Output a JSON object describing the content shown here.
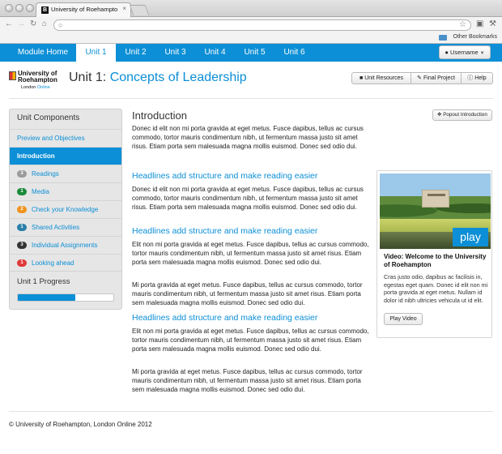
{
  "browser": {
    "tab_title": "University of Roehampton, L",
    "tab_close": "×",
    "favicon_letter": "B",
    "bookmarks_label": "Other Bookmarks"
  },
  "nav": {
    "items": [
      "Module Home",
      "Unit 1",
      "Unit 2",
      "Unit 3",
      "Unit 4",
      "Unit 5",
      "Unit 6"
    ],
    "active": "Unit 1",
    "user_label": "Username"
  },
  "header": {
    "logo_line1": "University of",
    "logo_line2": "Roehampton",
    "logo_line3a": "London ",
    "logo_line3b": "Online",
    "unit_prefix": "Unit 1: ",
    "unit_title": "Concepts of Leadership",
    "buttons": [
      "Unit Resources",
      "Final Project",
      "Help"
    ]
  },
  "sidebar": {
    "title": "Unit Components",
    "items": [
      {
        "label": "Preview and Objectives"
      },
      {
        "label": "Introduction",
        "active": true
      },
      {
        "label": "Readings",
        "badge": "3",
        "badge_color": "#9b9b9b"
      },
      {
        "label": "Media",
        "badge": "1",
        "badge_color": "#1a8a3a"
      },
      {
        "label": "Check your Knowledge",
        "badge": "2",
        "badge_color": "#f0931e"
      },
      {
        "label": "Shared Activities",
        "badge": "1",
        "badge_color": "#2a7fa8"
      },
      {
        "label": "Individual Assignments",
        "badge": "3",
        "badge_color": "#333333"
      },
      {
        "label": "Looking ahead",
        "badge": "1",
        "badge_color": "#e03a3a"
      }
    ],
    "progress_label": "Unit 1 Progress",
    "progress_fraction": 0.6
  },
  "main": {
    "heading": "Introduction",
    "popout_label": "Popout Introduction",
    "intro_para": "Donec id elit non mi porta gravida at eget metus. Fusce dapibus, tellus ac cursus commodo, tortor mauris condimentum nibh, ut fermentum massa justo sit amet risus. Etiam porta sem malesuada magna mollis euismod. Donec sed odio dui.",
    "sections": [
      {
        "heading": "Headlines add structure and make reading easier",
        "paras": [
          "Donec id elit non mi porta gravida at eget metus. Fusce dapibus, tellus ac cursus commodo, tortor mauris condimentum nibh, ut fermentum massa justo sit amet risus. Etiam porta sem malesuada magna mollis euismod. Donec sed odio dui."
        ]
      },
      {
        "heading": "Headlines add structure and make reading easier",
        "paras": [
          "Elit non mi porta gravida at eget metus. Fusce dapibus, tellus ac cursus commodo, tortor mauris condimentum nibh, ut fermentum massa justo sit amet risus. Etiam porta sem malesuada magna mollis euismod. Donec sed odio dui.",
          "Mi porta gravida at eget metus. Fusce dapibus, tellus ac cursus commodo, tortor mauris condimentum nibh, ut fermentum massa justo sit amet risus. Etiam porta sem malesuada magna mollis euismod. Donec sed odio dui."
        ]
      },
      {
        "heading": "Headlines add structure and make reading easier",
        "paras": [
          "Elit non mi porta gravida at eget metus. Fusce dapibus, tellus ac cursus commodo, tortor mauris condimentum nibh, ut fermentum massa justo sit amet risus. Etiam porta sem malesuada magna mollis euismod. Donec sed odio dui.",
          "Mi porta gravida at eget metus. Fusce dapibus, tellus ac cursus commodo, tortor mauris condimentum nibh, ut fermentum massa justo sit amet risus. Etiam porta sem malesuada magna mollis euismod. Donec sed odio dui."
        ]
      }
    ]
  },
  "video": {
    "play_label": "play",
    "title": "Video: Welcome to the University of Roehampton",
    "desc": "Cras justo odio, dapibus ac facilisis in, egestas eget quam. Donec id elit non mi porta gravida at eget metus. Nullam id dolor id nibh ultricies vehicula ut id elit.",
    "button": "Play Video"
  },
  "footer": {
    "text": "© University of Roehampton, London Online 2012"
  },
  "colors": {
    "brand_blue": "#0c8fd6"
  },
  "icons": [
    "back-icon",
    "forward-icon",
    "reload-icon",
    "home-icon",
    "globe-icon",
    "star-icon",
    "page-icon",
    "wrench-icon",
    "folder-icon",
    "user-icon",
    "book-icon",
    "pencil-icon",
    "info-icon",
    "popout-icon"
  ]
}
